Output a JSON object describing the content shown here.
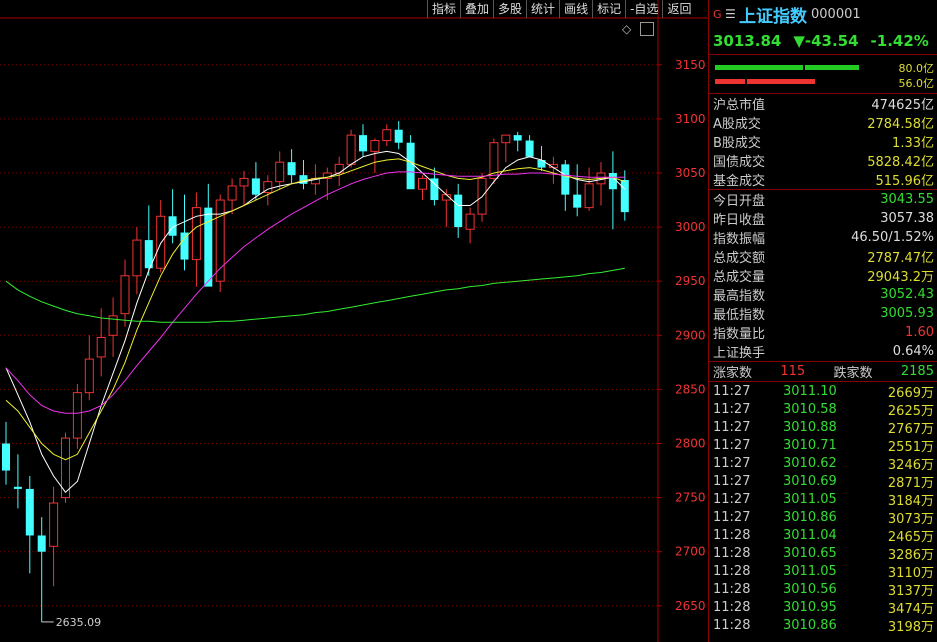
{
  "toolbar": [
    "指标",
    "叠加",
    "多股",
    "统计",
    "画线",
    "标记",
    "-自选",
    "返回"
  ],
  "chart": {
    "y_ticks": [
      "3150",
      "3100",
      "3050",
      "3000",
      "2950",
      "2900",
      "2850",
      "2800",
      "2750",
      "2700",
      "2650"
    ],
    "min_label": "2635.09",
    "candles": [
      [
        2800,
        2820,
        2762,
        2775
      ],
      [
        2760,
        2790,
        2740,
        2758
      ],
      [
        2758,
        2770,
        2680,
        2715
      ],
      [
        2715,
        2732,
        2635.09,
        2700
      ],
      [
        2705,
        2760,
        2668,
        2745
      ],
      [
        2750,
        2810,
        2745,
        2805
      ],
      [
        2805,
        2855,
        2795,
        2847
      ],
      [
        2847,
        2900,
        2840,
        2878
      ],
      [
        2880,
        2925,
        2862,
        2898
      ],
      [
        2900,
        2935,
        2880,
        2918
      ],
      [
        2920,
        2970,
        2908,
        2955
      ],
      [
        2955,
        3000,
        2938,
        2988
      ],
      [
        2988,
        3020,
        2955,
        2962
      ],
      [
        2962,
        3025,
        2958,
        3010
      ],
      [
        3010,
        3035,
        2985,
        2992
      ],
      [
        2995,
        3030,
        2960,
        2970
      ],
      [
        2970,
        3032,
        2945,
        3018
      ],
      [
        3018,
        3040,
        2950,
        2945
      ],
      [
        2950,
        3030,
        2940,
        3025
      ],
      [
        3025,
        3045,
        3012,
        3038
      ],
      [
        3038,
        3052,
        3020,
        3045
      ],
      [
        3045,
        3060,
        3025,
        3030
      ],
      [
        3032,
        3048,
        3020,
        3042
      ],
      [
        3042,
        3070,
        3035,
        3060
      ],
      [
        3060,
        3072,
        3040,
        3048
      ],
      [
        3048,
        3062,
        3035,
        3040
      ],
      [
        3040,
        3058,
        3030,
        3045
      ],
      [
        3045,
        3055,
        3025,
        3050
      ],
      [
        3050,
        3065,
        3038,
        3058
      ],
      [
        3058,
        3090,
        3055,
        3085
      ],
      [
        3085,
        3095,
        3065,
        3070
      ],
      [
        3070,
        3082,
        3050,
        3080
      ],
      [
        3080,
        3095,
        3075,
        3090
      ],
      [
        3090,
        3098,
        3072,
        3078
      ],
      [
        3078,
        3085,
        3048,
        3035
      ],
      [
        3035,
        3048,
        3025,
        3045
      ],
      [
        3045,
        3055,
        3020,
        3025
      ],
      [
        3025,
        3035,
        3000,
        3030
      ],
      [
        3030,
        3040,
        2990,
        3000
      ],
      [
        2998,
        3018,
        2985,
        3012
      ],
      [
        3012,
        3050,
        3005,
        3045
      ],
      [
        3045,
        3082,
        3040,
        3078
      ],
      [
        3078,
        3085,
        3060,
        3085
      ],
      [
        3085,
        3088,
        3070,
        3080
      ],
      [
        3080,
        3085,
        3065,
        3065
      ],
      [
        3062,
        3075,
        3052,
        3055
      ],
      [
        3055,
        3065,
        3040,
        3058
      ],
      [
        3058,
        3062,
        3015,
        3030
      ],
      [
        3030,
        3058,
        3010,
        3018
      ],
      [
        3018,
        3055,
        3015,
        3040
      ],
      [
        3040,
        3060,
        3020,
        3050
      ],
      [
        3050,
        3070,
        2998,
        3035
      ],
      [
        3043.55,
        3052.43,
        3005.93,
        3013.84
      ]
    ],
    "ma_fast": [
      2870,
      2845,
      2820,
      2790,
      2770,
      2755,
      2765,
      2800,
      2835,
      2865,
      2895,
      2930,
      2960,
      2985,
      3000,
      3005,
      3010,
      3012,
      3012,
      3015,
      3020,
      3028,
      3035,
      3038,
      3040,
      3042,
      3044,
      3046,
      3050,
      3058,
      3065,
      3068,
      3070,
      3068,
      3060,
      3050,
      3040,
      3030,
      3020,
      3020,
      3028,
      3042,
      3055,
      3062,
      3065,
      3062,
      3055,
      3048,
      3044,
      3042,
      3044,
      3046,
      3035
    ],
    "ma_mid": [
      2840,
      2830,
      2815,
      2800,
      2790,
      2785,
      2790,
      2810,
      2830,
      2850,
      2875,
      2905,
      2930,
      2955,
      2975,
      2990,
      3000,
      3005,
      3010,
      3015,
      3020,
      3025,
      3030,
      3035,
      3040,
      3043,
      3045,
      3046,
      3048,
      3052,
      3056,
      3060,
      3062,
      3063,
      3060,
      3056,
      3052,
      3048,
      3045,
      3044,
      3046,
      3050,
      3052,
      3054,
      3055,
      3053,
      3050,
      3047,
      3045,
      3044,
      3045,
      3046,
      3042
    ],
    "ma_slow": [
      2870,
      2858,
      2845,
      2835,
      2830,
      2828,
      2828,
      2830,
      2835,
      2845,
      2858,
      2872,
      2885,
      2898,
      2912,
      2925,
      2938,
      2950,
      2962,
      2972,
      2982,
      2990,
      2998,
      3005,
      3012,
      3018,
      3024,
      3030,
      3035,
      3040,
      3044,
      3047,
      3050,
      3051,
      3051,
      3050,
      3049,
      3048,
      3047,
      3047,
      3047,
      3048,
      3049,
      3049,
      3050,
      3050,
      3049,
      3048,
      3047,
      3046,
      3046,
      3046,
      3046
    ],
    "ma_long": [
      2950,
      2942,
      2936,
      2931,
      2927,
      2923,
      2920,
      2918,
      2916,
      2915,
      2914,
      2913,
      2913,
      2912,
      2912,
      2912,
      2912,
      2912,
      2913,
      2913,
      2914,
      2915,
      2916,
      2917,
      2918,
      2919,
      2921,
      2922,
      2924,
      2926,
      2928,
      2930,
      2932,
      2934,
      2936,
      2938,
      2940,
      2942,
      2943,
      2945,
      2946,
      2948,
      2949,
      2950,
      2951,
      2952,
      2953,
      2954,
      2955,
      2957,
      2958,
      2960,
      2962
    ]
  },
  "header": {
    "g": "G",
    "menu": "☰",
    "name": "上证指数",
    "code": "000001"
  },
  "quote": {
    "price": "3013.84",
    "change": "▼-43.54",
    "pct": "-1.42%"
  },
  "flow": {
    "buy": "80.0亿",
    "sell": "56.0亿"
  },
  "stats1": [
    {
      "label": "沪总市值",
      "value": "474625亿",
      "color": "w"
    },
    {
      "label": "A股成交",
      "value": "2784.58亿",
      "color": "y"
    },
    {
      "label": "B股成交",
      "value": "1.33亿",
      "color": "y"
    },
    {
      "label": "国债成交",
      "value": "5828.42亿",
      "color": "y"
    },
    {
      "label": "基金成交",
      "value": "515.96亿",
      "color": "y"
    }
  ],
  "stats2": [
    {
      "label": "今日开盘",
      "value": "3043.55",
      "color": "g2"
    },
    {
      "label": "昨日收盘",
      "value": "3057.38",
      "color": "w"
    },
    {
      "label": "指数振幅",
      "value": "46.50/1.52%",
      "color": "w"
    },
    {
      "label": "总成交额",
      "value": "2787.47亿",
      "color": "y"
    },
    {
      "label": "总成交量",
      "value": "29043.2万",
      "color": "y"
    },
    {
      "label": "最高指数",
      "value": "3052.43",
      "color": "g2"
    },
    {
      "label": "最低指数",
      "value": "3005.93",
      "color": "g2"
    },
    {
      "label": "指数量比",
      "value": "1.60",
      "color": "r"
    },
    {
      "label": "上证换手",
      "value": "0.64%",
      "color": "w"
    }
  ],
  "updown": {
    "up_label": "涨家数",
    "up": "115",
    "down_label": "跌家数",
    "down": "2185"
  },
  "ticks": [
    [
      "11:27",
      "3011.10",
      "2669万"
    ],
    [
      "11:27",
      "3010.58",
      "2625万"
    ],
    [
      "11:27",
      "3010.88",
      "2767万"
    ],
    [
      "11:27",
      "3010.71",
      "2551万"
    ],
    [
      "11:27",
      "3010.62",
      "3246万"
    ],
    [
      "11:27",
      "3010.69",
      "2871万"
    ],
    [
      "11:27",
      "3011.05",
      "3184万"
    ],
    [
      "11:27",
      "3010.86",
      "3073万"
    ],
    [
      "11:28",
      "3011.04",
      "2465万"
    ],
    [
      "11:28",
      "3010.65",
      "3286万"
    ],
    [
      "11:28",
      "3011.05",
      "3110万"
    ],
    [
      "11:28",
      "3010.56",
      "3137万"
    ],
    [
      "11:28",
      "3010.95",
      "3474万"
    ],
    [
      "11:28",
      "3010.86",
      "3198万"
    ]
  ]
}
